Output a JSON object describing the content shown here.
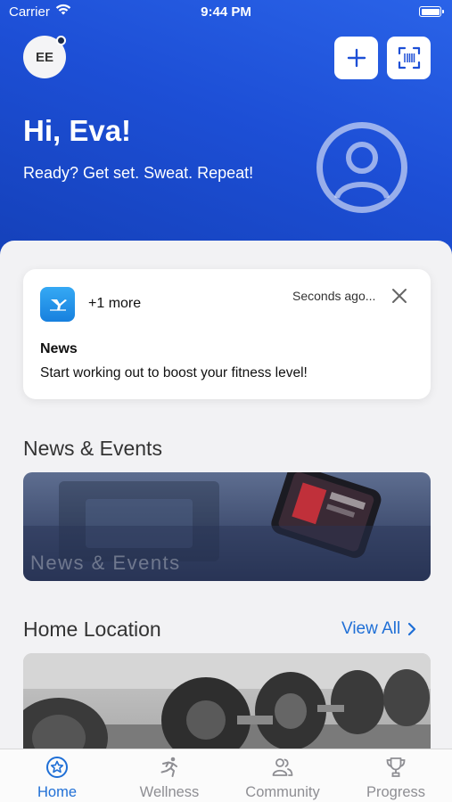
{
  "status_bar": {
    "carrier": "Carrier",
    "time": "9:44 PM"
  },
  "header": {
    "avatar_initials": "EE",
    "greeting": "Hi, Eva!",
    "tagline": "Ready? Get set. Sweat. Repeat!",
    "add_icon": "plus-icon",
    "scan_icon": "barcode-scan-icon",
    "profile_icon": "user-profile-icon"
  },
  "notification": {
    "app_icon": "ymca-app-icon",
    "more": "+1 more",
    "time": "Seconds ago...",
    "title": "News",
    "body": "Start working out to boost your fitness level!"
  },
  "news_section": {
    "title": "News & Events",
    "card_text": "News & Events"
  },
  "home_location": {
    "title": "Home Location",
    "view_all": "View All"
  },
  "tabs": [
    {
      "label": "Home",
      "icon": "star-badge-icon",
      "active": true
    },
    {
      "label": "Wellness",
      "icon": "running-person-icon",
      "active": false
    },
    {
      "label": "Community",
      "icon": "people-icon",
      "active": false
    },
    {
      "label": "Progress",
      "icon": "trophy-icon",
      "active": false
    }
  ],
  "colors": {
    "header_blue": "#1d4fd6",
    "accent": "#1f6fd6",
    "tab_inactive": "#8e8e93"
  }
}
